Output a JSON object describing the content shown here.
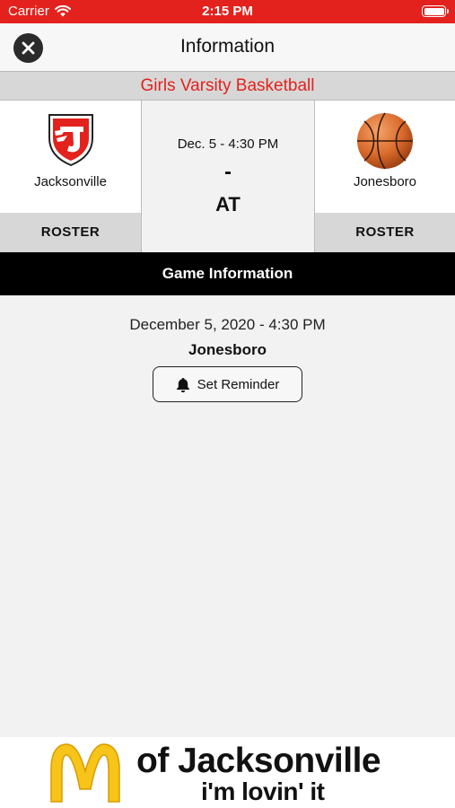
{
  "status_bar": {
    "carrier": "Carrier",
    "time": "2:15 PM"
  },
  "nav": {
    "title": "Information",
    "close_icon": "close-icon"
  },
  "sport": {
    "title": "Girls Varsity Basketball"
  },
  "home_team": {
    "name": "Jacksonville",
    "roster_label": "ROSTER",
    "logo": "jacksonville-shield-logo"
  },
  "away_team": {
    "name": "Jonesboro",
    "roster_label": "ROSTER",
    "logo": "basketball-icon"
  },
  "matchup": {
    "date": "Dec. 5 - 4:30 PM",
    "score": "-",
    "location_prefix": "AT"
  },
  "game_info": {
    "header": "Game Information",
    "full_date": "December 5, 2020 - 4:30 PM",
    "location": "Jonesboro",
    "reminder_label": "Set Reminder",
    "reminder_icon": "bell-icon"
  },
  "ad": {
    "line1": "of Jacksonville",
    "line2": "i'm lovin' it",
    "logo": "mcdonalds-arches-logo"
  },
  "colors": {
    "accent_red": "#e3221d",
    "header_black": "#000000",
    "gray_band": "#d7d7d7"
  }
}
